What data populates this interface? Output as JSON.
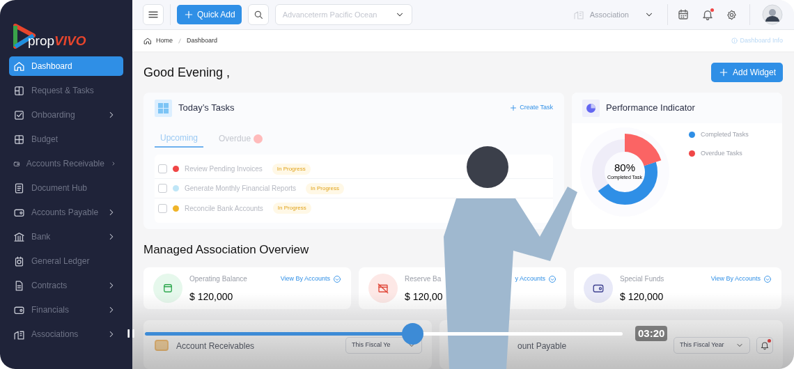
{
  "sidebar": {
    "logo": {
      "prefix": "prop",
      "suffix": "VIVO"
    },
    "items": [
      {
        "label": "Dashboard",
        "selected": true,
        "has_submenu": false
      },
      {
        "label": "Request & Tasks",
        "selected": false,
        "has_submenu": false
      },
      {
        "label": "Onboarding",
        "selected": false,
        "has_submenu": true
      },
      {
        "label": "Budget",
        "selected": false,
        "has_submenu": false
      },
      {
        "label": "Accounts Receivable",
        "selected": false,
        "has_submenu": true
      },
      {
        "label": "Document Hub",
        "selected": false,
        "has_submenu": false
      },
      {
        "label": "Accounts Payable",
        "selected": false,
        "has_submenu": true
      },
      {
        "label": "Bank",
        "selected": false,
        "has_submenu": true
      },
      {
        "label": "General Ledger",
        "selected": false,
        "has_submenu": false
      },
      {
        "label": "Contracts",
        "selected": false,
        "has_submenu": true
      },
      {
        "label": "Financials",
        "selected": false,
        "has_submenu": true
      },
      {
        "label": "Associations",
        "selected": false,
        "has_submenu": true
      }
    ]
  },
  "header": {
    "quick_add": "Quick Add",
    "community_select": "Advanceterm Pacific Ocean",
    "association_select": "Association",
    "notification_unread": true
  },
  "breadcrumb": [
    "Home",
    "Dashboard"
  ],
  "dashboard_info": "Dashboard Info",
  "greeting": "Good Evening ,",
  "add_widget": "Add Widget",
  "tasks": {
    "title": "Today’s Tasks",
    "create_task": "Create Task",
    "tabs": [
      {
        "label": "Upcoming",
        "selected": true,
        "has_badge": false
      },
      {
        "label": "Overdue",
        "selected": false,
        "has_badge": true
      }
    ],
    "rows": [
      {
        "name": "Review Pending Invoices",
        "color": "#f04646",
        "checked": false,
        "status": "In Progress"
      },
      {
        "name": "Generate Monthly Financial Reports",
        "color": "#bfe6f7",
        "checked": false,
        "status": "In Progress"
      },
      {
        "name": "Reconcile Bank Accounts",
        "color": "#f0b429",
        "checked": false,
        "status": "In Progress"
      }
    ]
  },
  "performance": {
    "title": "Performance Indicator",
    "value": "80%",
    "caption": "Completed Task",
    "legend": [
      {
        "label": "Completed Tasks",
        "color": "#2f8fe6"
      },
      {
        "label": "Overdue Tasks",
        "color": "#f04646"
      }
    ]
  },
  "overview": {
    "title": "Managed Association Overview",
    "cards": [
      {
        "kind": "operating",
        "title": "Operating Balance",
        "amount": "$ 120,000",
        "link": "View By Accounts"
      },
      {
        "kind": "reserve",
        "title": "Reserve Ba",
        "amount": "$ 120,00",
        "link": "y Accounts"
      },
      {
        "kind": "special",
        "title": "Special Funds",
        "amount": "$ 120,000",
        "link": "View By Accounts"
      }
    ]
  },
  "lower_cards": [
    {
      "title": "Account Receivables",
      "period": "This Fiscal Ye",
      "alert": false
    },
    {
      "title": "ount Payable",
      "period": "This Fiscal Year",
      "alert": true
    }
  ],
  "video": {
    "playing": true,
    "level": 0.56,
    "time": "03:20"
  }
}
